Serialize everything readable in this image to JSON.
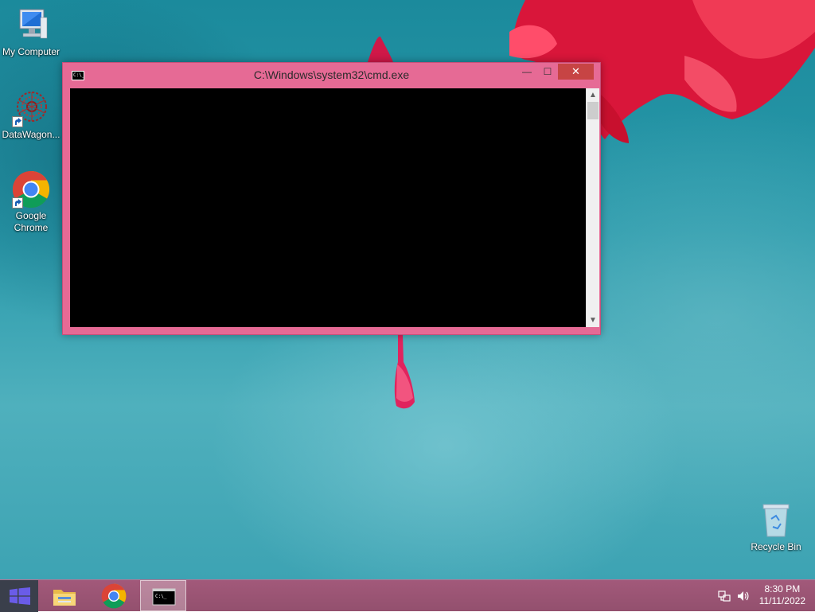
{
  "desktop": {
    "icons": [
      {
        "label": "My Computer"
      },
      {
        "label": "DataWagon..."
      },
      {
        "label": "Google Chrome"
      },
      {
        "label": "Recycle Bin"
      }
    ]
  },
  "cmd_window": {
    "title": "C:\\Windows\\system32\\cmd.exe",
    "icon": "cmd-icon",
    "minimize_glyph": "—",
    "maximize_glyph": "☐",
    "close_glyph": "✕",
    "scroll_up_glyph": "▲",
    "scroll_down_glyph": "▼"
  },
  "taskbar": {
    "pinned": [
      {
        "name": "file-explorer",
        "icon": "folder-icon"
      },
      {
        "name": "google-chrome",
        "icon": "chrome-icon"
      },
      {
        "name": "command-prompt",
        "icon": "cmd-icon",
        "active": true
      }
    ],
    "tray": {
      "time": "8:30 PM",
      "date": "11/11/2022",
      "icons": [
        "network-icon",
        "volume-icon"
      ]
    }
  },
  "colors": {
    "window_frame": "#e66a95",
    "close_button": "#c74444",
    "taskbar": "#93506e",
    "start_button": "#3a3f4b",
    "console_background": "#000000"
  }
}
